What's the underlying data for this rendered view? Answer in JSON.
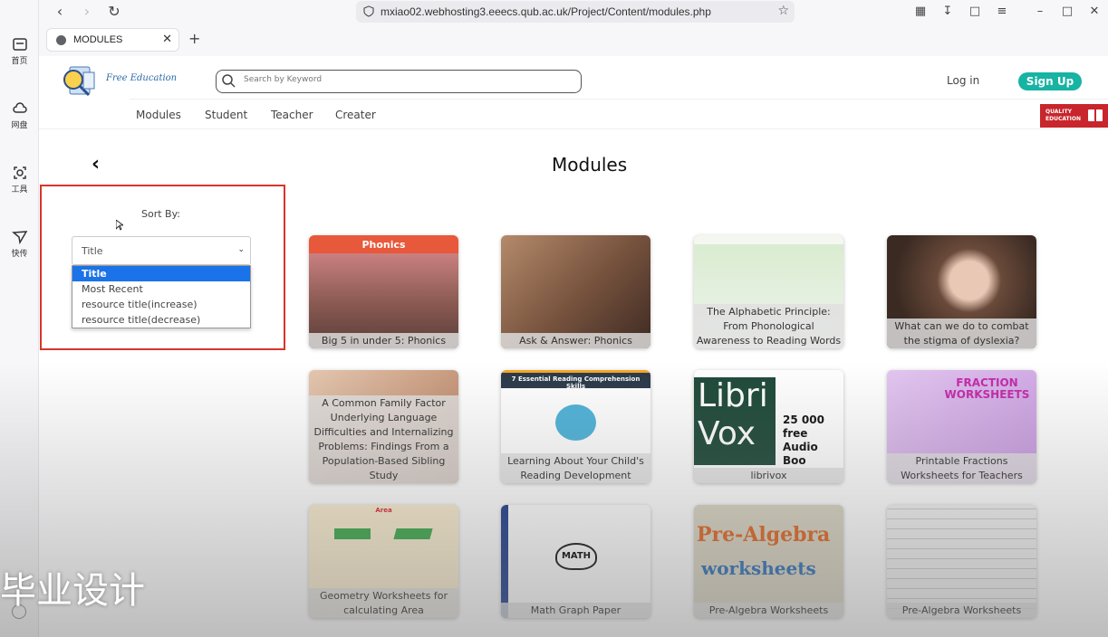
{
  "browser": {
    "url": "mxiao02.webhosting3.eeecs.qub.ac.uk/Project/Content/modules.php",
    "tab_title": "MODULES",
    "sidebar": [
      {
        "label": "首页",
        "icon": "home-icon"
      },
      {
        "label": "网盘",
        "icon": "cloud-icon"
      },
      {
        "label": "工具",
        "icon": "tools-icon"
      },
      {
        "label": "快传",
        "icon": "send-icon"
      }
    ]
  },
  "site": {
    "logo_text": "Free Education",
    "search_placeholder": "Search by Keyword",
    "login_label": "Log in",
    "signup_label": "Sign Up",
    "menu": [
      "Modules",
      "Student",
      "Teacher",
      "Creater"
    ],
    "badge_line1": "QUALITY",
    "badge_line2": "EDUCATION",
    "accent": "#17b3a3"
  },
  "page": {
    "title": "Modules",
    "sort_label": "Sort By:",
    "sort_selected": "Title",
    "sort_options": [
      "Title",
      "Most Recent",
      "resource title(increase)",
      "resource title(decrease)"
    ]
  },
  "cards": [
    {
      "caption": "Big 5 in under 5: Phonics",
      "banner": "Phonics"
    },
    {
      "caption": "Ask & Answer: Phonics"
    },
    {
      "caption": "The Alphabetic Principle: From Phonological Awareness to Reading Words"
    },
    {
      "caption": "What can we do to combat the stigma of dyslexia?"
    },
    {
      "caption": "A Common Family Factor Underlying Language Difficulties and Internalizing Problems: Findings From a Population-Based Sibling Study"
    },
    {
      "caption": "Learning About Your Child's Reading Development",
      "banner": "7 Essential Reading Comprehension Skills"
    },
    {
      "caption": "librivox",
      "thumb_line1": "25 000 free",
      "thumb_line2": "Audio Boo"
    },
    {
      "caption": "Printable Fractions Worksheets for Teachers",
      "thumb_title": "FRACTION WORKSHEETS"
    },
    {
      "caption": "Geometry Worksheets for calculating Area",
      "thumb_title": "Area"
    },
    {
      "caption": "Math Graph Paper",
      "thumb_title": "MATH"
    },
    {
      "caption": "Pre-Algebra Worksheets",
      "thumb_line1": "Pre-Algebra",
      "thumb_line2": "worksheets"
    },
    {
      "caption": "Pre-Algebra Worksheets"
    }
  ],
  "overlay_text": "毕业设计"
}
